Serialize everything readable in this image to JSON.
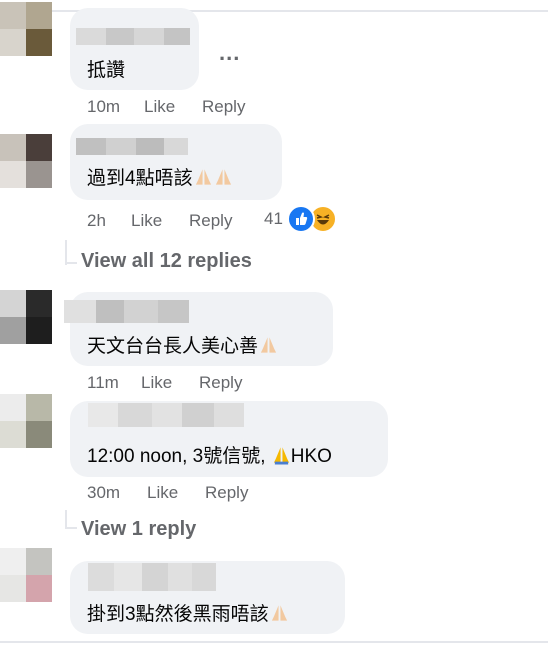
{
  "comments": [
    {
      "text": "抵讚",
      "time": "10m",
      "like": "Like",
      "reply": "Reply",
      "more": "..."
    },
    {
      "text": "過到4點唔該",
      "time": "2h",
      "like": "Like",
      "reply": "Reply",
      "reaction_count": "41",
      "reactions": [
        "like-icon",
        "haha-icon"
      ]
    },
    {
      "text": "天文台台長人美心善",
      "time": "11m",
      "like": "Like",
      "reply": "Reply"
    },
    {
      "text_before": "12:00 noon, 3號信號, ",
      "text_after": "HKO",
      "time": "30m",
      "like": "Like",
      "reply": "Reply"
    },
    {
      "text": "掛到3點然後黑雨唔該",
      "time": "",
      "like": "",
      "reply": ""
    }
  ],
  "view_replies": [
    {
      "label": "View all 12 replies"
    },
    {
      "label": "View 1 reply"
    }
  ],
  "colors": {
    "bubble": "#f0f2f5",
    "meta": "#65676b",
    "text": "#050505",
    "like_blue": "#1877f2",
    "haha_yellow": "#f7b125"
  }
}
